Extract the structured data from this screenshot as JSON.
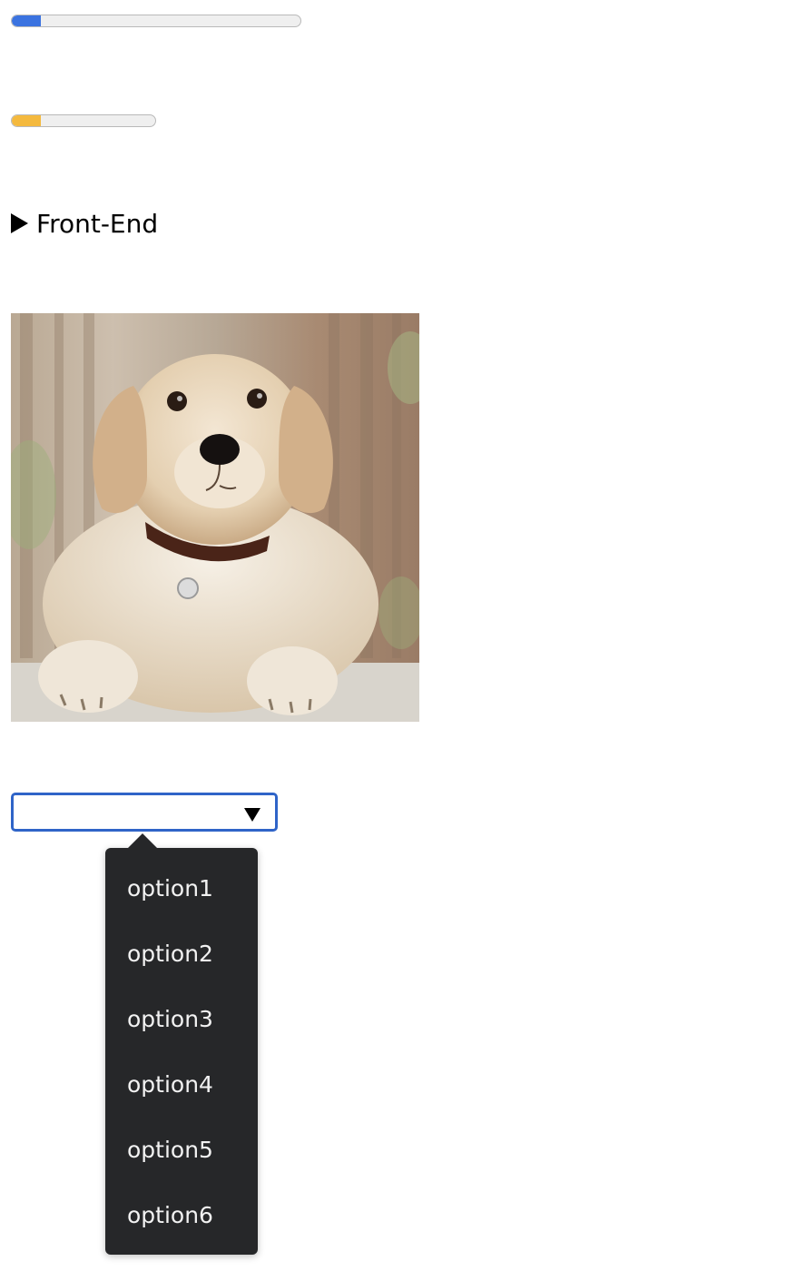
{
  "progress_bars": [
    {
      "value_percent": 10,
      "color": "#3b73e0"
    },
    {
      "value_percent": 20,
      "color": "#f4b93e"
    }
  ],
  "details": {
    "summary": "Front-End",
    "open": false
  },
  "image": {
    "subject": "golden retriever puppy"
  },
  "select": {
    "value": "",
    "accent_color": "#2f64c8",
    "options": [
      "option1",
      "option2",
      "option3",
      "option4",
      "option5",
      "option6"
    ]
  },
  "icons": {
    "disclosure": "triangle-right-icon",
    "select_arrow": "triangle-down-icon"
  }
}
